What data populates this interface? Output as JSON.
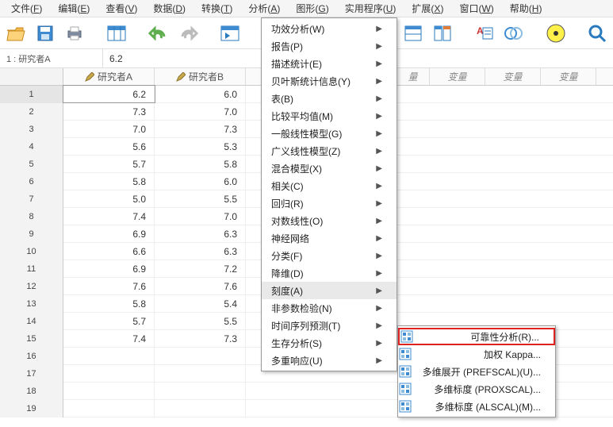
{
  "menubar": [
    {
      "label": "文件",
      "m": "F"
    },
    {
      "label": "编辑",
      "m": "E"
    },
    {
      "label": "查看",
      "m": "V"
    },
    {
      "label": "数据",
      "m": "D"
    },
    {
      "label": "转换",
      "m": "T"
    },
    {
      "label": "分析",
      "m": "A"
    },
    {
      "label": "图形",
      "m": "G"
    },
    {
      "label": "实用程序",
      "m": "U"
    },
    {
      "label": "扩展",
      "m": "X"
    },
    {
      "label": "窗口",
      "m": "W"
    },
    {
      "label": "帮助",
      "m": "H"
    }
  ],
  "cellref": {
    "name": "1 : 研究者A",
    "value": "6.2"
  },
  "columns": [
    "研究者A",
    "研究者B"
  ],
  "extra_var_headers": [
    "量",
    "变量",
    "变量",
    "变量"
  ],
  "rows": [
    {
      "n": 1,
      "a": "6.2",
      "b": "6.0"
    },
    {
      "n": 2,
      "a": "7.3",
      "b": "7.0"
    },
    {
      "n": 3,
      "a": "7.0",
      "b": "7.3"
    },
    {
      "n": 4,
      "a": "5.6",
      "b": "5.3"
    },
    {
      "n": 5,
      "a": "5.7",
      "b": "5.8"
    },
    {
      "n": 6,
      "a": "5.8",
      "b": "6.0"
    },
    {
      "n": 7,
      "a": "5.0",
      "b": "5.5"
    },
    {
      "n": 8,
      "a": "7.4",
      "b": "7.0"
    },
    {
      "n": 9,
      "a": "6.9",
      "b": "6.3"
    },
    {
      "n": 10,
      "a": "6.6",
      "b": "6.3"
    },
    {
      "n": 11,
      "a": "6.9",
      "b": "7.2"
    },
    {
      "n": 12,
      "a": "7.6",
      "b": "7.6"
    },
    {
      "n": 13,
      "a": "5.8",
      "b": "5.4"
    },
    {
      "n": 14,
      "a": "5.7",
      "b": "5.5"
    },
    {
      "n": 15,
      "a": "7.4",
      "b": "7.3"
    }
  ],
  "empty_rows": [
    16,
    17,
    18,
    19
  ],
  "analyze_menu": [
    {
      "label": "功效分析",
      "m": "W",
      "sub": true
    },
    {
      "label": "报告",
      "m": "P",
      "sub": true
    },
    {
      "label": "描述统计",
      "m": "E",
      "sub": true
    },
    {
      "label": "贝叶斯统计信息",
      "m": "Y",
      "sub": true
    },
    {
      "label": "表",
      "m": "B",
      "sub": true
    },
    {
      "label": "比较平均值",
      "m": "M",
      "sub": true
    },
    {
      "label": "一般线性模型",
      "m": "G",
      "sub": true
    },
    {
      "label": "广义线性模型",
      "m": "Z",
      "sub": true
    },
    {
      "label": "混合模型",
      "m": "X",
      "sub": true
    },
    {
      "label": "相关",
      "m": "C",
      "sub": true
    },
    {
      "label": "回归",
      "m": "R",
      "sub": true
    },
    {
      "label": "对数线性",
      "m": "O",
      "sub": true
    },
    {
      "label": "神经网络",
      "m": "",
      "sub": true
    },
    {
      "label": "分类",
      "m": "F",
      "sub": true
    },
    {
      "label": "降维",
      "m": "D",
      "sub": true
    },
    {
      "label": "刻度",
      "m": "A",
      "sub": true,
      "highlight": true
    },
    {
      "label": "非参数检验",
      "m": "N",
      "sub": true
    },
    {
      "label": "时间序列预测",
      "m": "T",
      "sub": true
    },
    {
      "label": "生存分析",
      "m": "S",
      "sub": true
    },
    {
      "label": "多重响应",
      "m": "U",
      "sub": true
    }
  ],
  "scale_menu": [
    {
      "label": "可靠性分析",
      "m": "R",
      "ellipsis": true,
      "highlight": true,
      "icon": "reliability"
    },
    {
      "label": "加权 Kappa...",
      "m": "",
      "icon": "kappa"
    },
    {
      "label": "多维展开 (PREFSCAL)",
      "m": "U",
      "ellipsis": true,
      "icon": "prefscal"
    },
    {
      "label": "多维标度 (PROXSCAL)...",
      "m": "",
      "icon": "proxscal"
    },
    {
      "label": "多维标度 (ALSCAL)",
      "m": "M",
      "ellipsis": true,
      "icon": "alscal"
    }
  ]
}
